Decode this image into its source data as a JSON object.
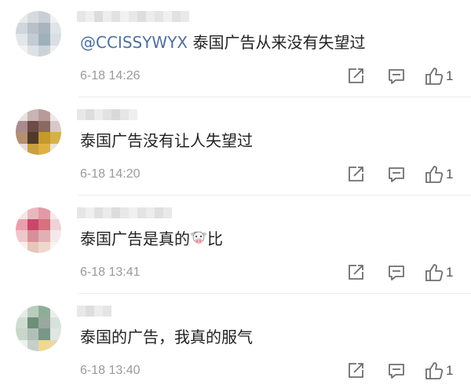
{
  "comments": [
    {
      "mention": "@CCISSYWYX",
      "text": " 泰国广告从来没有失望过",
      "time": "6-18  14:26",
      "likes": "1",
      "avatar_colors": [
        "#e8eaec",
        "#d7dbe0",
        "#c9cfd6",
        "#eef0f2",
        "#cfd6dc",
        "#b8c0c8",
        "#a9b4be",
        "#dfe4e8",
        "#e3e7ea",
        "#c3ccd3",
        "#9fb0bd",
        "#d8dee2",
        "#f0f2f4",
        "#dde2e6",
        "#cbd3d9",
        "#eceff1"
      ],
      "name_colors": [
        "#e6e6e6",
        "#efefef",
        "#dcdcdc",
        "#ededed",
        "#e2e2e2",
        "#f1f1f1",
        "#e8e8e8",
        "#dedede",
        "#ececec",
        "#e4e4e4",
        "#f0f0f0",
        "#e1e1e1",
        "#e9e9e9"
      ]
    },
    {
      "mention": "",
      "text": "泰国广告没有让人失望过",
      "time": "6-18  14:20",
      "likes": "1",
      "avatar_colors": [
        "#e9e0e0",
        "#c9b3b3",
        "#b89a9c",
        "#efe8e8",
        "#a98a8e",
        "#6e4a48",
        "#8a6a60",
        "#d9c8c8",
        "#b49070",
        "#503a2a",
        "#c59a2a",
        "#d8b04a",
        "#e8dcd4",
        "#c8a040",
        "#e0b040",
        "#efe4d8"
      ],
      "name_colors": [
        "#e8e8e8",
        "#dddddd",
        "#ececec",
        "#e2e2e2",
        "#d9d9d9",
        "#e6e6e6",
        "#efefef"
      ]
    },
    {
      "mention": "",
      "text": "泰国广告是真的",
      "text_after": "比",
      "emoji": "cow-face",
      "time": "6-18  13:41",
      "likes": "1",
      "avatar_colors": [
        "#f4e6e8",
        "#e9b8bf",
        "#e39aa6",
        "#f6eaec",
        "#e8a0ad",
        "#c8486a",
        "#d8707e",
        "#f0d2d6",
        "#eec8cc",
        "#d89098",
        "#e0b0b4",
        "#f5e8ea",
        "#f7efef",
        "#e6c6b8",
        "#eed8cc",
        "#f8f2f0"
      ],
      "name_colors": [
        "#e6e6e6",
        "#efefef",
        "#e0e0e0",
        "#ebebeb",
        "#dcdcdc",
        "#e8e8e8",
        "#f0f0f0",
        "#e3e3e3",
        "#ececec",
        "#dfdfdf",
        "#e9e9e9"
      ]
    },
    {
      "mention": "",
      "text": "泰国的广告，我真的服气",
      "time": "6-18  13:40",
      "likes": "1",
      "avatar_colors": [
        "#e4ebe6",
        "#b9cdbf",
        "#8fae98",
        "#e9efeb",
        "#cfdcd2",
        "#6e8e78",
        "#9aa8a0",
        "#d8e2dc",
        "#c8d6cc",
        "#b0c0b8",
        "#7a968a",
        "#e0e6e2",
        "#eef1ef",
        "#c6d0cb",
        "#f0d890",
        "#e8d8a8"
      ],
      "name_colors": [
        "#e8e8e8",
        "#dedede",
        "#ececec",
        "#e4e4e4"
      ]
    }
  ],
  "icons": {
    "share": "share-icon",
    "comment": "comment-icon",
    "like": "thumbs-up-icon"
  }
}
